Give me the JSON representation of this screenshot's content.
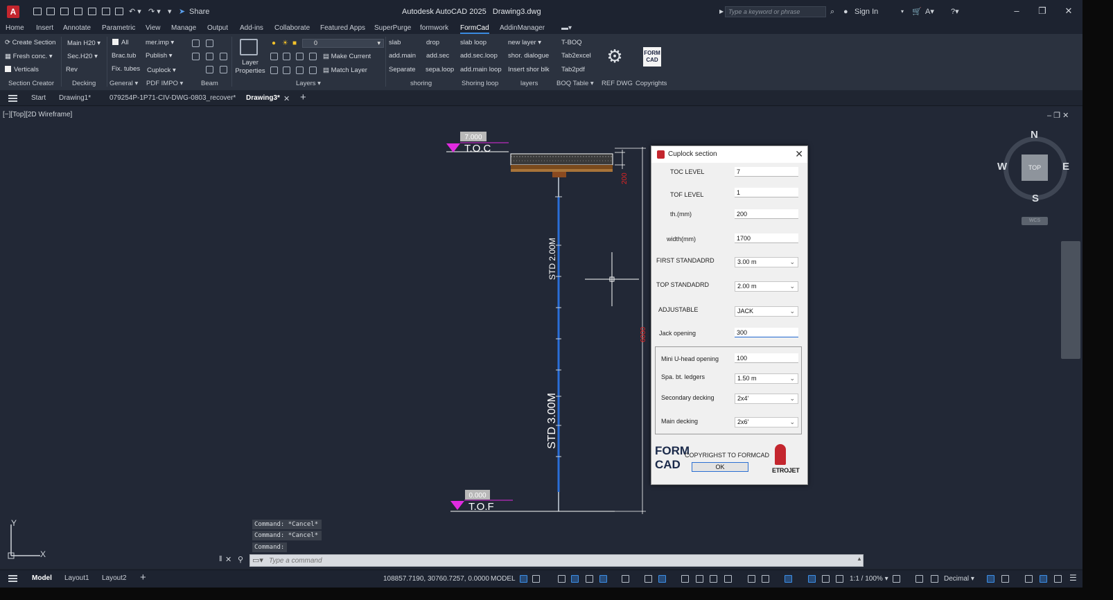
{
  "app": {
    "title": "Autodesk AutoCAD 2025",
    "document": "Drawing3.dwg",
    "share_label": "Share",
    "search_placeholder": "Type a keyword or phrase",
    "sign_in": "Sign In"
  },
  "menu": [
    "Home",
    "Insert",
    "Annotate",
    "Parametric",
    "View",
    "Manage",
    "Output",
    "Add-ins",
    "Collaborate",
    "Featured Apps",
    "SuperPurge",
    "formwork",
    "FormCad",
    "AddinManager"
  ],
  "menu_active": "FormCad",
  "ribbon": {
    "create_section": "Create Section",
    "fresh_conc": "Fresh conc.",
    "verticals": "Verticals",
    "section_creator": "Section Creator",
    "main_h20": "Main H20",
    "sec_h20": "Sec.H20",
    "rev": "Rev",
    "decking": "Decking",
    "all": "All",
    "brac_tub": "Brac.tub",
    "fix_tubes": "Fix. tubes",
    "general": "General",
    "mer_imp": "mer.imp",
    "publish": "Publish",
    "cuplock": "Cuplock",
    "pdf_impo": "PDF IMPO",
    "beam": "Beam",
    "layer_properties": "Layer Properties",
    "layer_value": "0",
    "make_current": "Make Current",
    "match_layer": "Match Layer",
    "layers": "Layers",
    "slab": "slab",
    "add_main": "add.main",
    "separate": "Separate",
    "drop": "drop",
    "add_sec": "add.sec",
    "sepa_loop": "sepa.loop",
    "shoring": "shoring",
    "slab_loop": "slab loop",
    "add_sec_loop": "add.sec.loop",
    "add_main_loop": "add.main loop",
    "shoring_loop": "Shoring loop",
    "new_layer": "new layer",
    "shor_dialogue": "shor. dialogue",
    "insert_shor_blk": "Insert shor blk",
    "layers_lower": "layers",
    "t_boq": "T-BOQ",
    "tab2excel": "Tab2excel",
    "tab2pdf": "Tab2pdf",
    "boq_table": "BOQ Table",
    "ref_dwg": "REF DWG",
    "copyrights": "Copyrights",
    "formcad_logo": "FORM CAD"
  },
  "file_tabs": [
    "Start",
    "Drawing1*",
    "079254P-1P71-CIV-DWG-0803_recover*",
    "Drawing3*"
  ],
  "file_tab_active": "Drawing3*",
  "viewport": {
    "label": "[−][Top][2D Wireframe]",
    "toc_text": "T.O.C",
    "toc_level": "7.000",
    "tof_text": "T.O.F",
    "tof_level": "0.000",
    "std_upper": "STD 2.00M",
    "std_lower": "STD 3.00M",
    "dim_slab": "200",
    "dim_total": "6000"
  },
  "viewcube": {
    "n": "N",
    "s": "S",
    "e": "E",
    "w": "W",
    "top": "TOP",
    "wcs": "WCS"
  },
  "command": {
    "history": [
      "Command: *Cancel*",
      "Command: *Cancel*",
      "Command:"
    ],
    "placeholder": "Type a command"
  },
  "status": {
    "layouts": [
      "Model",
      "Layout1",
      "Layout2"
    ],
    "coords": "108857.7190, 30760.7257, 0.0000",
    "model": "MODEL",
    "scale": "1:1 / 100%",
    "units": "Decimal"
  },
  "dialog": {
    "title": "Cuplock section",
    "toc_level_label": "TOC LEVEL",
    "toc_level_value": "7",
    "tof_level_label": "TOF LEVEL",
    "tof_level_value": "1",
    "th_label": "th.(mm)",
    "th_value": "200",
    "width_label": "width(mm)",
    "width_value": "1700",
    "first_std_label": "FIRST STANDADRD",
    "first_std_value": "3.00 m",
    "top_std_label": "TOP STANDADRD",
    "top_std_value": "2.00 m",
    "adjustable_label": "ADJUSTABLE",
    "adjustable_value": "JACK",
    "jack_label": "Jack opening",
    "jack_value": "300",
    "mini_uhead_label": "Mini U-head opening",
    "mini_uhead_value": "100",
    "spa_label": "Spa. bt. ledgers",
    "spa_value": "1.50 m",
    "sec_decking_label": "Secondary decking",
    "sec_decking_value": "2x4'",
    "main_decking_label": "Main decking",
    "main_decking_value": "2x6'",
    "logo_left": "FORM CAD",
    "copyright": "COPYRIGHST TO FORMCAD",
    "ok": "OK",
    "logo_right": "ETROJET"
  }
}
